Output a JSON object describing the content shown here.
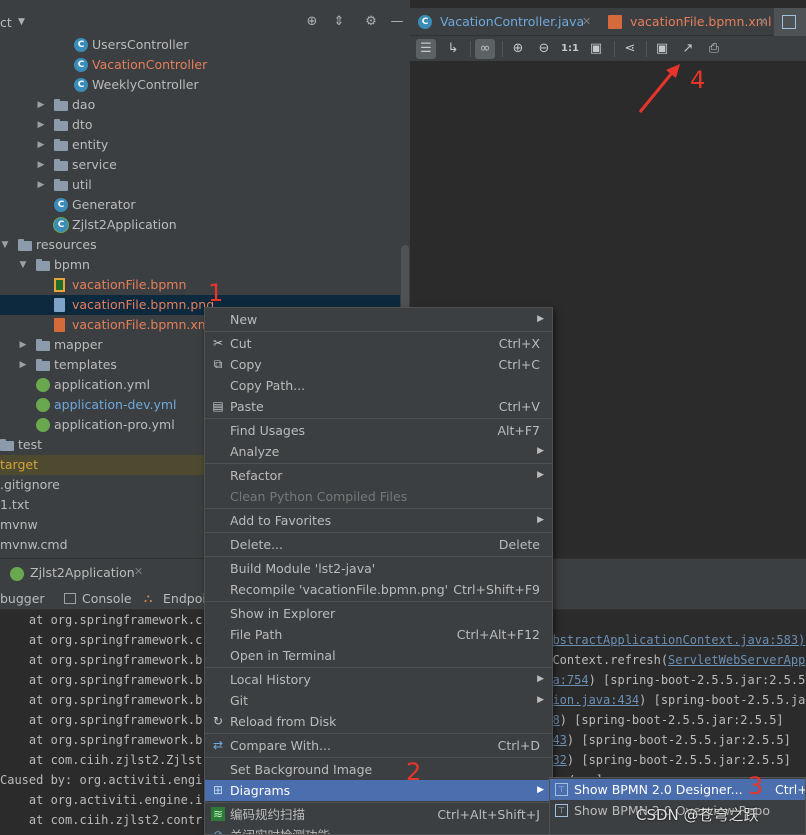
{
  "project": {
    "title": "ct",
    "tree": [
      {
        "label": "UsersController",
        "kind": "class",
        "depth": 4
      },
      {
        "label": "VacationController",
        "kind": "class",
        "depth": 4,
        "color": "red"
      },
      {
        "label": "WeeklyController",
        "kind": "class",
        "depth": 4
      },
      {
        "label": "dao",
        "kind": "folder",
        "depth": 3
      },
      {
        "label": "dto",
        "kind": "folder",
        "depth": 3
      },
      {
        "label": "entity",
        "kind": "folder",
        "depth": 3
      },
      {
        "label": "service",
        "kind": "folder",
        "depth": 3
      },
      {
        "label": "util",
        "kind": "folder",
        "depth": 3
      },
      {
        "label": "Generator",
        "kind": "class",
        "depth": 3
      },
      {
        "label": "Zjlst2Application",
        "kind": "springclass",
        "depth": 3
      },
      {
        "label": "resources",
        "kind": "folder-open",
        "depth": 0
      },
      {
        "label": "bpmn",
        "kind": "folder-open",
        "depth": 1
      },
      {
        "label": "vacationFile.bpmn",
        "kind": "bpmn",
        "depth": 2,
        "color": "red"
      },
      {
        "label": "vacationFile.bpmn.png",
        "kind": "png",
        "depth": 2,
        "color": "red"
      },
      {
        "label": "vacationFile.bpmn.xml",
        "kind": "xml",
        "depth": 2,
        "color": "red"
      },
      {
        "label": "mapper",
        "kind": "folder",
        "depth": 1
      },
      {
        "label": "templates",
        "kind": "folder",
        "depth": 1
      },
      {
        "label": "application.yml",
        "kind": "spring",
        "depth": 1
      },
      {
        "label": "application-dev.yml",
        "kind": "spring",
        "depth": 1,
        "color": "blue"
      },
      {
        "label": "application-pro.yml",
        "kind": "spring",
        "depth": 1
      },
      {
        "label": "test",
        "kind": "folder",
        "depth": -1
      },
      {
        "label": "target",
        "kind": "none",
        "depth": -1,
        "color": "target"
      },
      {
        "label": ".gitignore",
        "kind": "none",
        "depth": -1
      },
      {
        "label": "1.txt",
        "kind": "none",
        "depth": -1
      },
      {
        "label": "mvnw",
        "kind": "none",
        "depth": -1
      },
      {
        "label": "mvnw.cmd",
        "kind": "none",
        "depth": -1
      }
    ]
  },
  "editor": {
    "tabs": [
      {
        "label": "VacationController.java"
      },
      {
        "label": "vacationFile.bpmn.xml"
      }
    ]
  },
  "run": {
    "title": "Zjlst2Application",
    "tabs": [
      "bugger",
      "Console",
      "Endpoin"
    ]
  },
  "console": {
    "lines": [
      "    at org.springframework.c",
      "    at org.springframework.c",
      "    at org.springframework.b",
      "    at org.springframework.b",
      "    at org.springframework.b",
      "    at org.springframework.b",
      "    at org.springframework.b",
      "    at com.ciih.zjlst2.Zjlst",
      "Caused by: org.activiti.engi",
      "    at org.activiti.engine.i",
      "    at com.ciih.zjlst2.contr"
    ],
    "right": [
      {
        "pre": "",
        "link": "",
        "post": ""
      },
      {
        "pre": "",
        "link": "(AbstractApplicationContext.java:583)",
        "post": ""
      },
      {
        "pre": "onContext.refresh(",
        "link": "ServletWebServerApp",
        "post": ""
      },
      {
        "pre": "",
        "link": "ava:754",
        "post": ") [spring-boot-2.5.5.jar:2.5.5"
      },
      {
        "pre": "",
        "link": "ation.java:434",
        "post": ") [spring-boot-2.5.5.ja"
      },
      {
        "pre": "",
        "link": "338",
        "post": ") [spring-boot-2.5.5.jar:2.5.5]"
      },
      {
        "pre": "",
        "link": "1343",
        "post": ") [spring-boot-2.5.5.jar:2.5.5]"
      },
      {
        "pre": "",
        "link": "1332",
        "post": ") [spring-boot-2.5.5.jar:2.5.5]"
      },
      {
        "pre": "sses/:na]",
        "link": "",
        "post": ""
      },
      {
        "pre": "",
        "link": "",
        "post": ""
      },
      {
        "pre": "",
        "link": "ler.java:43",
        "post": ") ~[classes/:na] <4 intern"
      }
    ]
  },
  "context_menu": {
    "items": [
      {
        "label": "New",
        "submenu": true
      },
      {
        "sep": true
      },
      {
        "label": "Cut",
        "shortcut": "Ctrl+X",
        "icon": "cut-icon",
        "glyph": "✂"
      },
      {
        "label": "Copy",
        "shortcut": "Ctrl+C",
        "icon": "copy-icon",
        "glyph": "⧉"
      },
      {
        "label": "Copy Path...",
        "shortcut": ""
      },
      {
        "label": "Paste",
        "shortcut": "Ctrl+V",
        "icon": "paste-icon",
        "glyph": "▤"
      },
      {
        "sep": true
      },
      {
        "label": "Find Usages",
        "shortcut": "Alt+F7"
      },
      {
        "label": "Analyze",
        "submenu": true
      },
      {
        "sep": true
      },
      {
        "label": "Refactor",
        "submenu": true
      },
      {
        "label": "Clean Python Compiled Files",
        "disabled": true
      },
      {
        "sep": true
      },
      {
        "label": "Add to Favorites",
        "submenu": true
      },
      {
        "sep": true
      },
      {
        "label": "Delete...",
        "shortcut": "Delete"
      },
      {
        "sep": true
      },
      {
        "label": "Build Module 'lst2-java'"
      },
      {
        "label": "Recompile 'vacationFile.bpmn.png'",
        "shortcut": "Ctrl+Shift+F9"
      },
      {
        "sep": true
      },
      {
        "label": "Show in Explorer"
      },
      {
        "label": "File Path",
        "shortcut": "Ctrl+Alt+F12"
      },
      {
        "label": "Open in Terminal"
      },
      {
        "sep": true
      },
      {
        "label": "Local History",
        "submenu": true
      },
      {
        "label": "Git",
        "submenu": true
      },
      {
        "label": "Reload from Disk",
        "icon": "reload-icon",
        "glyph": "↻"
      },
      {
        "sep": true
      },
      {
        "label": "Compare With...",
        "shortcut": "Ctrl+D",
        "icon": "compare-icon",
        "glyph": "⇄"
      },
      {
        "sep": true
      },
      {
        "label": "Set Background Image"
      },
      {
        "label": "Diagrams",
        "submenu": true,
        "active": true,
        "icon": "diagram-icon",
        "glyph": "⊞"
      },
      {
        "sep": true
      },
      {
        "label": "编码规约扫描",
        "shortcut": "Ctrl+Alt+Shift+J",
        "icon": "scan-icon",
        "glyph": "≋"
      },
      {
        "label": "关闭实时检测功能",
        "icon": "realtime-icon",
        "glyph": "⊘"
      }
    ]
  },
  "submenu": {
    "items": [
      {
        "label": "Show BPMN 2.0 Designer...",
        "shortcut": "Ctrl+A",
        "active": true
      },
      {
        "label": "Show BPMN 2.0 Overview Repo",
        "shortcut": ""
      }
    ]
  },
  "annotations": [
    "1",
    "2",
    "3",
    "4"
  ],
  "watermark": "CSDN @苍穹之跃",
  "colors": {
    "menu_bg": "#3c3f41",
    "menu_active": "#4b6eaf",
    "panel_bg": "#3c3f41",
    "editor_bg": "#2b2b2b",
    "annotation": "#e8352c"
  }
}
